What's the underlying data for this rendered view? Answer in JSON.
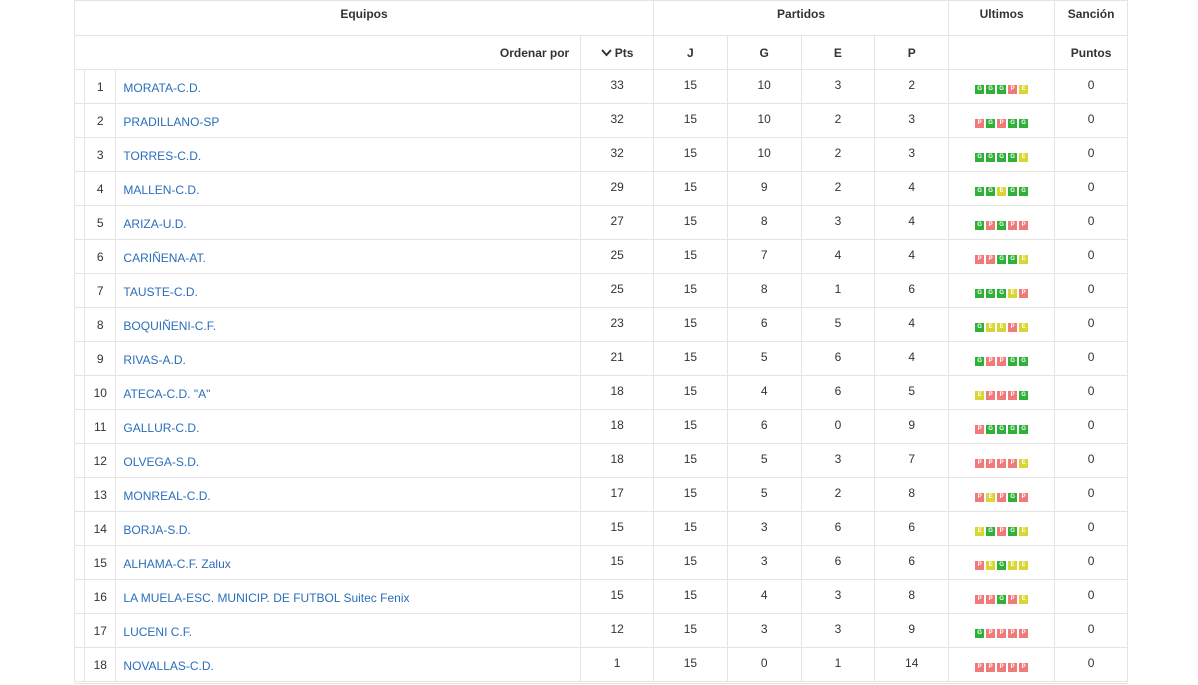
{
  "header": {
    "group_equipos": "Equipos",
    "group_partidos": "Partidos",
    "group_ultimos": "Ultimos",
    "group_sancion": "Sanción",
    "sort_label": "Ordenar por",
    "col_pts": "Pts",
    "col_j": "J",
    "col_g": "G",
    "col_e": "E",
    "col_p": "P",
    "col_puntos": "Puntos"
  },
  "rows": [
    {
      "pos": "1",
      "team": "MORATA-C.D.",
      "pts": "33",
      "j": "15",
      "g": "10",
      "e": "3",
      "p": "2",
      "last": [
        "G",
        "G",
        "G",
        "P",
        "E"
      ],
      "san": "0"
    },
    {
      "pos": "2",
      "team": "PRADILLANO-SP",
      "pts": "32",
      "j": "15",
      "g": "10",
      "e": "2",
      "p": "3",
      "last": [
        "P",
        "G",
        "P",
        "G",
        "G"
      ],
      "san": "0"
    },
    {
      "pos": "3",
      "team": "TORRES-C.D.",
      "pts": "32",
      "j": "15",
      "g": "10",
      "e": "2",
      "p": "3",
      "last": [
        "G",
        "G",
        "G",
        "G",
        "E"
      ],
      "san": "0"
    },
    {
      "pos": "4",
      "team": "MALLEN-C.D.",
      "pts": "29",
      "j": "15",
      "g": "9",
      "e": "2",
      "p": "4",
      "last": [
        "G",
        "G",
        "E",
        "G",
        "G"
      ],
      "san": "0"
    },
    {
      "pos": "5",
      "team": "ARIZA-U.D.",
      "pts": "27",
      "j": "15",
      "g": "8",
      "e": "3",
      "p": "4",
      "last": [
        "G",
        "P",
        "G",
        "P",
        "P"
      ],
      "san": "0"
    },
    {
      "pos": "6",
      "team": "CARIÑENA-AT.",
      "pts": "25",
      "j": "15",
      "g": "7",
      "e": "4",
      "p": "4",
      "last": [
        "P",
        "P",
        "G",
        "G",
        "E"
      ],
      "san": "0"
    },
    {
      "pos": "7",
      "team": "TAUSTE-C.D.",
      "pts": "25",
      "j": "15",
      "g": "8",
      "e": "1",
      "p": "6",
      "last": [
        "G",
        "G",
        "G",
        "E",
        "P"
      ],
      "san": "0"
    },
    {
      "pos": "8",
      "team": "BOQUIÑENI-C.F.",
      "pts": "23",
      "j": "15",
      "g": "6",
      "e": "5",
      "p": "4",
      "last": [
        "G",
        "E",
        "E",
        "P",
        "E"
      ],
      "san": "0"
    },
    {
      "pos": "9",
      "team": "RIVAS-A.D.",
      "pts": "21",
      "j": "15",
      "g": "5",
      "e": "6",
      "p": "4",
      "last": [
        "G",
        "P",
        "P",
        "G",
        "G"
      ],
      "san": "0"
    },
    {
      "pos": "10",
      "team": "ATECA-C.D. \"A\"",
      "pts": "18",
      "j": "15",
      "g": "4",
      "e": "6",
      "p": "5",
      "last": [
        "E",
        "P",
        "P",
        "P",
        "G"
      ],
      "san": "0"
    },
    {
      "pos": "11",
      "team": "GALLUR-C.D.",
      "pts": "18",
      "j": "15",
      "g": "6",
      "e": "0",
      "p": "9",
      "last": [
        "P",
        "G",
        "G",
        "G",
        "G"
      ],
      "san": "0"
    },
    {
      "pos": "12",
      "team": "OLVEGA-S.D.",
      "pts": "18",
      "j": "15",
      "g": "5",
      "e": "3",
      "p": "7",
      "last": [
        "P",
        "P",
        "P",
        "P",
        "E"
      ],
      "san": "0"
    },
    {
      "pos": "13",
      "team": "MONREAL-C.D.",
      "pts": "17",
      "j": "15",
      "g": "5",
      "e": "2",
      "p": "8",
      "last": [
        "P",
        "E",
        "P",
        "G",
        "P"
      ],
      "san": "0"
    },
    {
      "pos": "14",
      "team": "BORJA-S.D.",
      "pts": "15",
      "j": "15",
      "g": "3",
      "e": "6",
      "p": "6",
      "last": [
        "E",
        "G",
        "P",
        "G",
        "E"
      ],
      "san": "0"
    },
    {
      "pos": "15",
      "team": "ALHAMA-C.F. Zalux",
      "pts": "15",
      "j": "15",
      "g": "3",
      "e": "6",
      "p": "6",
      "last": [
        "P",
        "E",
        "G",
        "E",
        "E"
      ],
      "san": "0"
    },
    {
      "pos": "16",
      "team": "LA MUELA-ESC. MUNICIP. DE FUTBOL Suitec Fenix",
      "pts": "15",
      "j": "15",
      "g": "4",
      "e": "3",
      "p": "8",
      "last": [
        "P",
        "P",
        "G",
        "P",
        "E"
      ],
      "san": "0"
    },
    {
      "pos": "17",
      "team": "LUCENI C.F.",
      "pts": "12",
      "j": "15",
      "g": "3",
      "e": "3",
      "p": "9",
      "last": [
        "G",
        "P",
        "P",
        "P",
        "P"
      ],
      "san": "0"
    },
    {
      "pos": "18",
      "team": "NOVALLAS-C.D.",
      "pts": "1",
      "j": "15",
      "g": "0",
      "e": "1",
      "p": "14",
      "last": [
        "P",
        "P",
        "P",
        "P",
        "P"
      ],
      "san": "0"
    }
  ]
}
